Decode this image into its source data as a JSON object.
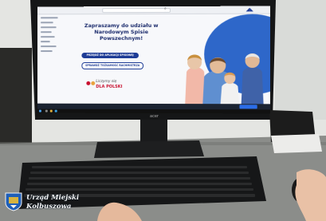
{
  "screen": {
    "headline": "Zapraszamy do udziału w Narodowym Spisie Powszechnym!",
    "primary_button": "PRZEJDŹ DO APLIKACJI SPISOWEJ",
    "secondary_button": "SPRAWDŹ TOŻSAMOŚĆ RACHMISTRZA",
    "slogan_line1": "Liczymy się",
    "slogan_line2": "DLA POLSKI"
  },
  "monitor": {
    "brand": "acer"
  },
  "watermark": {
    "line1": "Urząd Miejski",
    "line2": "Kolbuszowa"
  },
  "colors": {
    "census_blue": "#1e3c96",
    "circle_blue": "#2e67c9",
    "slogan_red": "#c8102e",
    "desk": "#8d8f8c",
    "wall": "#e6e7e5"
  }
}
